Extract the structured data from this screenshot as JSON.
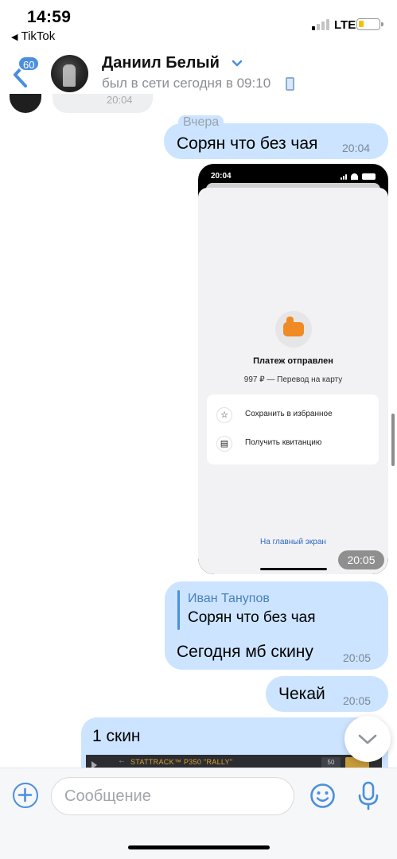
{
  "status_bar": {
    "time": "14:59",
    "back_app": "TikTok",
    "network": "LTE",
    "battery_color": "#f7c000"
  },
  "header": {
    "unread_count": "60",
    "contact_name": "Даниил Белый",
    "contact_status": "был в сети сегодня в 09:10",
    "icons": [
      "back-chevron-icon",
      "chevron-down-icon",
      "mobile-phone-icon"
    ]
  },
  "messages": {
    "partial_time": "20:04",
    "date_separator": "Вчера",
    "msg1": {
      "text": "Сорян что без чая",
      "time": "20:04"
    },
    "image_msg": {
      "time": "20:05",
      "screenshot": {
        "status_time": "20:04",
        "title": "Платеж отправлен",
        "subtitle": "997 ₽ — Перевод на карту",
        "actions": [
          {
            "icon": "star-icon",
            "label": "Сохранить в избранное"
          },
          {
            "icon": "receipt-icon",
            "label": "Получить квитанцию"
          }
        ],
        "home_link": "На главный экран"
      }
    },
    "reply_msg": {
      "quoted_author": "Иван Танупов",
      "quoted_text": "Сорян что без чая",
      "text": "Сегодня мб скину",
      "time": "20:05"
    },
    "msg3": {
      "text": "Чекай",
      "time": "20:05"
    },
    "incoming_last": {
      "text": "1 скин",
      "preview_skin": "STATTRACK™ P350 \"RALLY\"",
      "preview_chip": "50"
    }
  },
  "composer": {
    "placeholder": "Сообщение"
  },
  "colors": {
    "accent": "#4a8fdf",
    "outgoing_bubble": "#cce4ff",
    "incoming_bubble": "#eeeff1"
  }
}
